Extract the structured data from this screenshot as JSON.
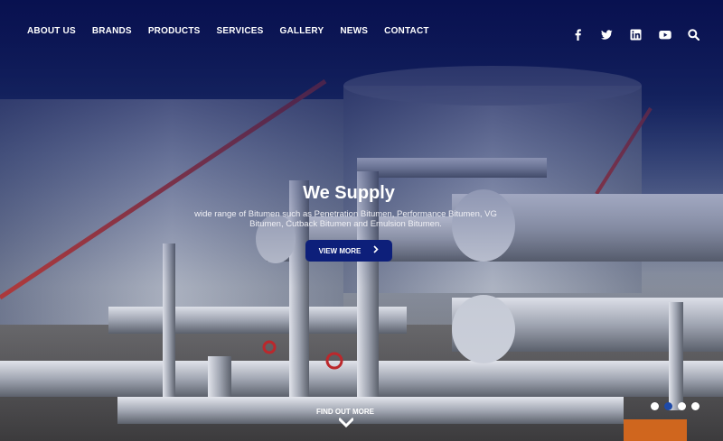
{
  "nav": {
    "items": [
      {
        "label": "ABOUT US"
      },
      {
        "label": "BRANDS"
      },
      {
        "label": "PRODUCTS"
      },
      {
        "label": "SERVICES"
      },
      {
        "label": "GALLERY"
      },
      {
        "label": "NEWS"
      },
      {
        "label": "CONTACT"
      }
    ]
  },
  "social": {
    "icons": [
      "facebook-icon",
      "twitter-icon",
      "linkedin-icon",
      "youtube-icon",
      "search-icon"
    ]
  },
  "hero": {
    "title": "We Supply",
    "subtitle": "wide range of Bitumen such as Penetration Bitumen, Performance Bitumen, VG Bitumen, Cutback Bitumen and Emulsion Bitumen.",
    "cta_label": "VIEW MORE",
    "cta_icon": "chevron-right-icon",
    "find_out_label": "FIND OUT MORE",
    "find_out_icon": "chevron-down-icon"
  },
  "slider": {
    "count": 4,
    "active_index": 1
  },
  "colors": {
    "primary": "#0d1f7a",
    "dot_active": "#1f4aa8"
  }
}
